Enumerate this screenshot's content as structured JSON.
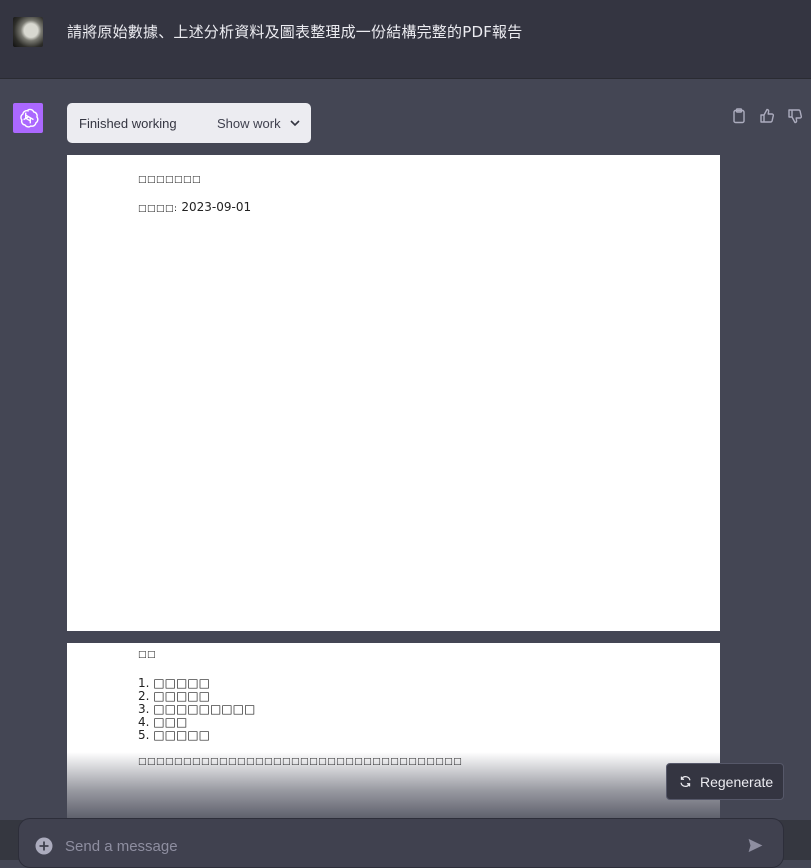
{
  "user_message": {
    "text": "請將原始數據、上述分析資料及圖表整理成一份結構完整的PDF報告"
  },
  "assistant": {
    "status": "Finished working",
    "show_work_label": "Show work"
  },
  "pdf_preview": {
    "page1": {
      "title": "□□□□□□□",
      "date_label": "□□□□:",
      "date_value": "2023-09-01"
    },
    "page2": {
      "heading": "□□",
      "toc": [
        "1. □□□□□",
        "2. □□□□□",
        "3. □□□□□□□□□",
        "4. □□□",
        "5. □□□□□"
      ],
      "paragraph": "□□□□□□□□□□□□□□□□□□□□□□□□□□□□□□□□□□□□"
    }
  },
  "controls": {
    "regenerate_label": "Regenerate",
    "composer_placeholder": "Send a message"
  },
  "icons": {
    "copy": "clipboard-icon",
    "like": "thumbs-up-icon",
    "dislike": "thumbs-down-icon",
    "regenerate": "refresh-icon",
    "send": "send-icon",
    "plus": "plus-circle-icon"
  },
  "colors": {
    "bot_avatar": "#ab68ff",
    "page_bg": "#ffffff",
    "chat_bg": "#444654"
  }
}
